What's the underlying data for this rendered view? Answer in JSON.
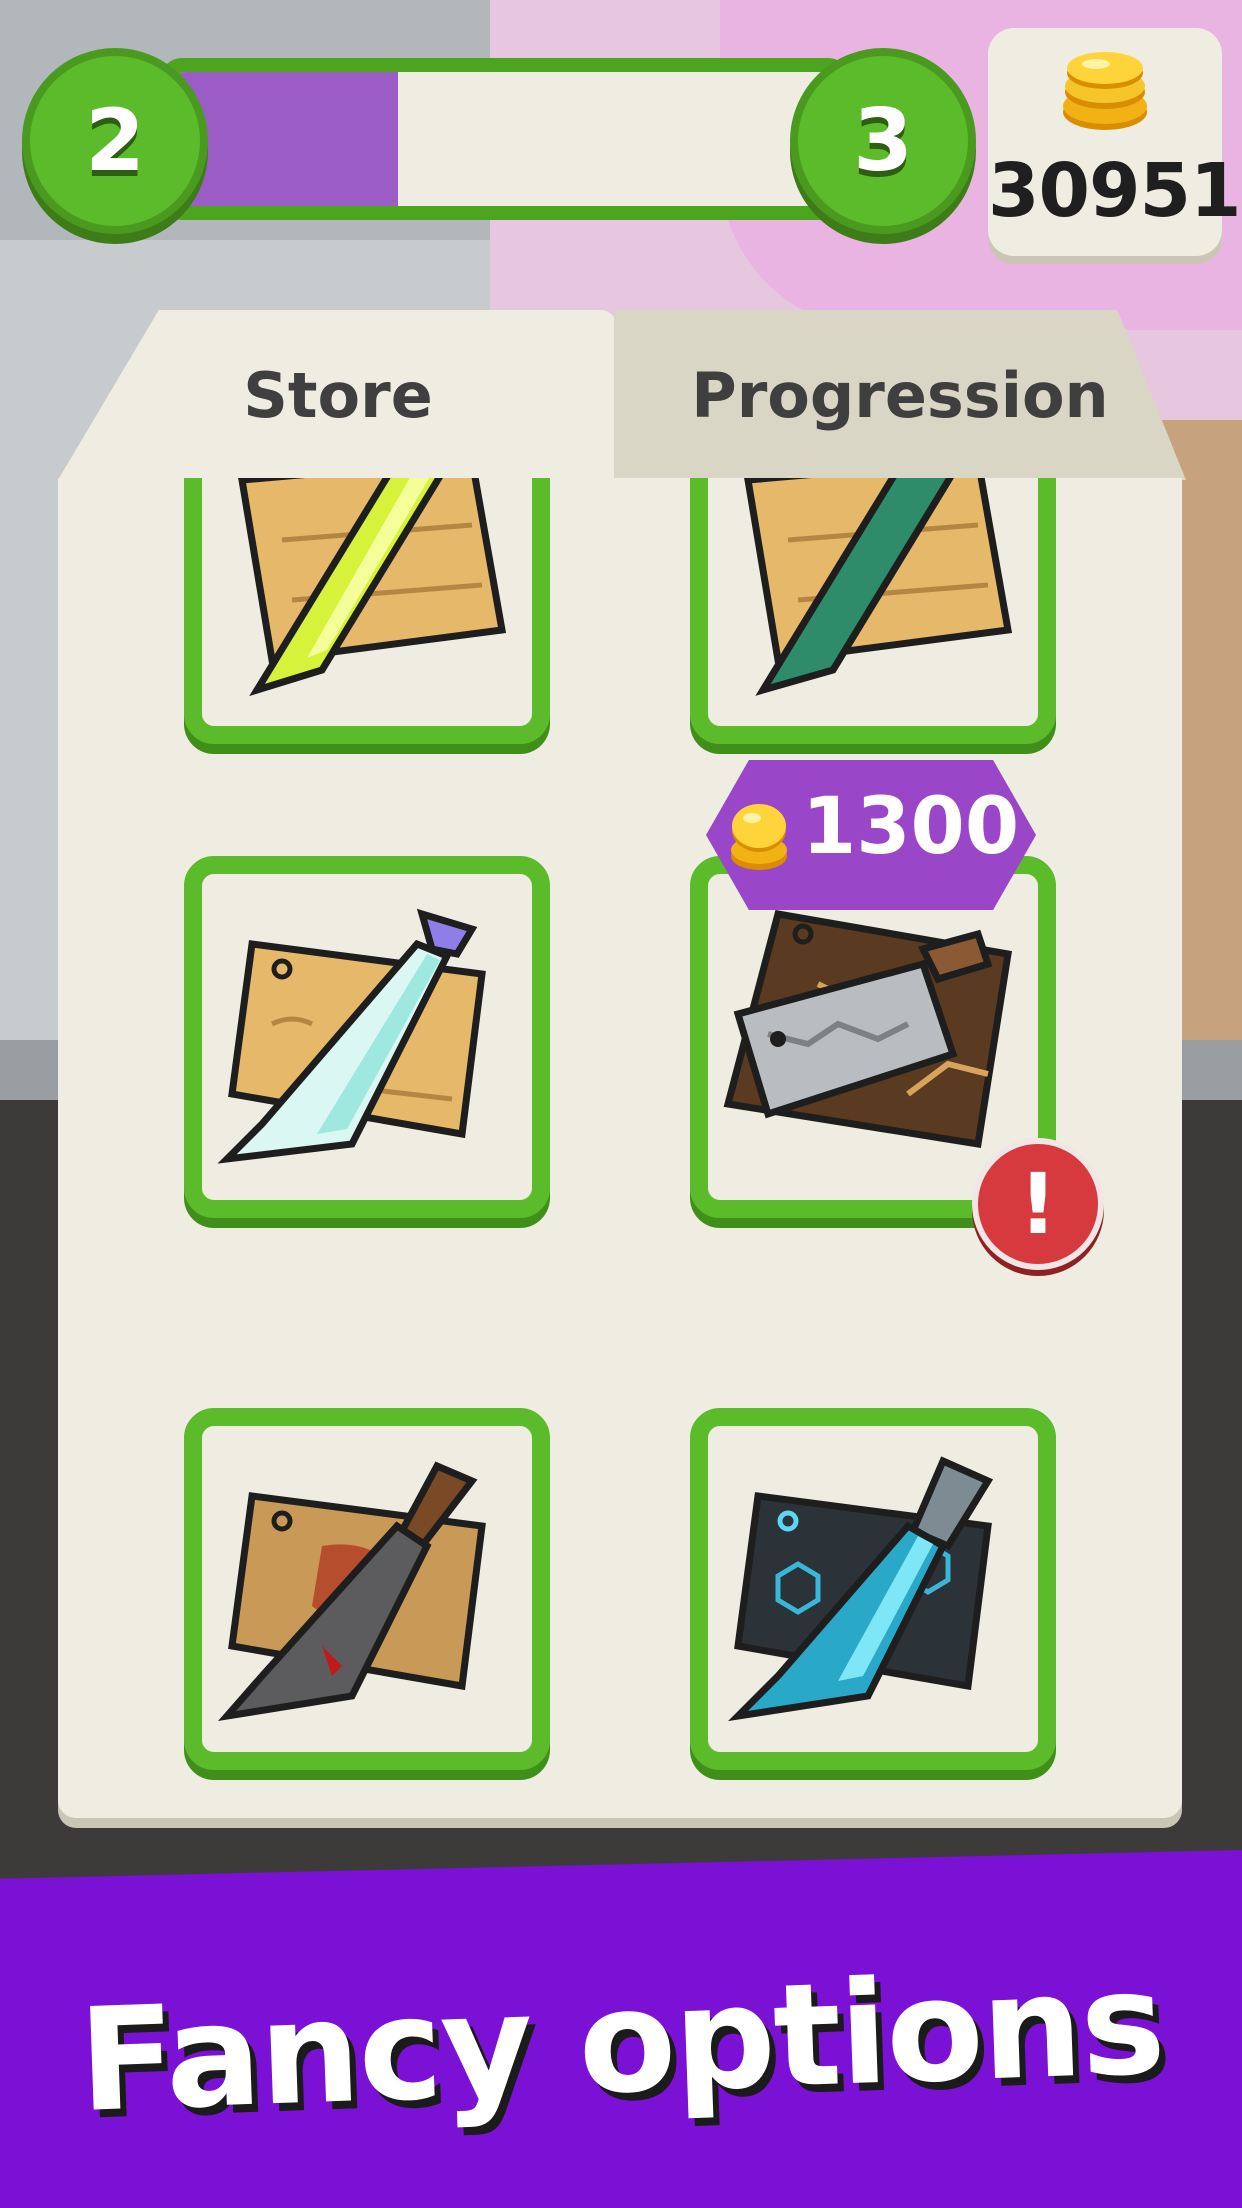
{
  "hud": {
    "current_level": "2",
    "next_level": "3",
    "level_progress": 0.34,
    "coins": "30951"
  },
  "tabs": [
    {
      "label": "Store",
      "active": true
    },
    {
      "label": "Progression",
      "active": false
    }
  ],
  "store": {
    "items": [
      {
        "name": "lime-knife-board",
        "state": "owned"
      },
      {
        "name": "teal-knife-board",
        "state": "owned"
      },
      {
        "name": "ice-blade-board",
        "state": "owned"
      },
      {
        "name": "steel-cleaver-dark-board",
        "state": "for-sale",
        "price": "1300",
        "alert": "!"
      },
      {
        "name": "bloody-knife-board",
        "state": "owned"
      },
      {
        "name": "hex-blue-knife-board",
        "state": "owned"
      }
    ]
  },
  "banner": {
    "text": "Fancy options"
  },
  "colors": {
    "green_frame": "#5cbb2a",
    "purple_fill": "#9b5cc6",
    "panel": "#efede2",
    "banner": "#7a11d4",
    "alert": "#d63a3e"
  }
}
